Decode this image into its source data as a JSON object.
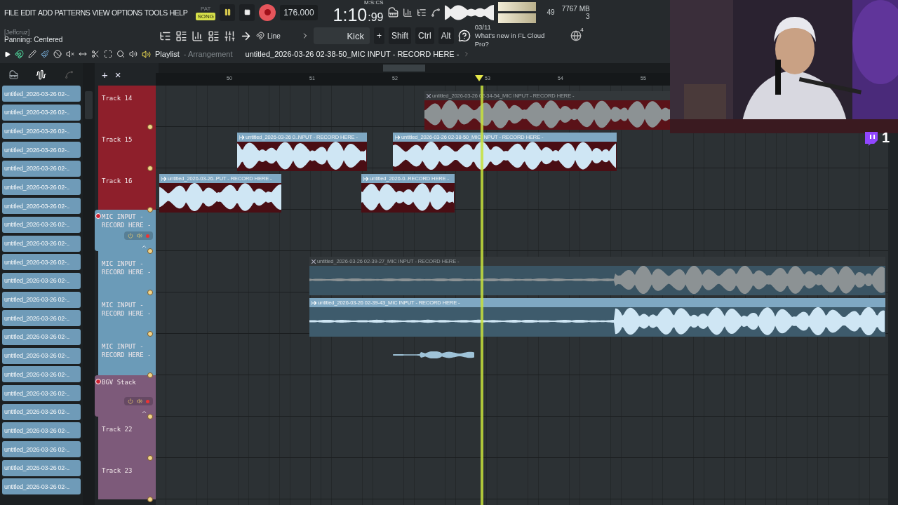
{
  "menu": [
    "FILE",
    "EDIT",
    "ADD",
    "PATTERNS",
    "VIEW",
    "OPTIONS",
    "TOOLS",
    "HELP"
  ],
  "mode": [
    {
      "label": "PAT",
      "selected": false
    },
    {
      "label": "SONG",
      "selected": true
    }
  ],
  "transport": {
    "playing": true,
    "recording": true,
    "tempo": "176.000"
  },
  "time": {
    "value": "1:10",
    "centiseconds": ":99",
    "format": "M:S:CS"
  },
  "cpu": {
    "voices": "49",
    "memory": "7767 MB",
    "polyphony": "3"
  },
  "hint": {
    "owner": "[Jeffcruz]",
    "message": "Panning: Centered"
  },
  "snap": {
    "value": "Line"
  },
  "pattern": {
    "value": "Kick",
    "add": "+"
  },
  "modifiers": [
    "Shift",
    "Ctrl",
    "Alt"
  ],
  "news": {
    "date": "03/11",
    "text": "What's new in FL Cloud Pro?"
  },
  "online": {
    "count": "4"
  },
  "playlist": {
    "title": "Playlist",
    "view": "- Arrangement",
    "clip": "untitled_2026-03-26 02-38-50_MIC INPUT - RECORD HERE -"
  },
  "clip_list": [
    "untitled_2026-03-26 02-..",
    "untitled_2026-03-26 02-..",
    "untitled_2026-03-26 02-..",
    "untitled_2026-03-26 02-..",
    "untitled_2026-03-26 02-..",
    "untitled_2026-03-26 02-..",
    "untitled_2026-03-26 02-..",
    "untitled_2026-03-26 02-..",
    "untitled_2026-03-26 02-..",
    "untitled_2026-03-26 02-..",
    "untitled_2026-03-26 02-..",
    "untitled_2026-03-26 02-..",
    "untitled_2026-03-26 02-..",
    "untitled_2026-03-26 02-..",
    "untitled_2026-03-26 02-..",
    "untitled_2026-03-26 02-..",
    "untitled_2026-03-26 02-..",
    "untitled_2026-03-26 02-..",
    "untitled_2026-03-26 02-..",
    "untitled_2026-03-26 02-..",
    "untitled_2026-03-26 02-..",
    "untitled_2026-03-26 02-.."
  ],
  "header_tools": {
    "add": "+",
    "delete": "×"
  },
  "ruler": [
    "50",
    "51",
    "52",
    "53",
    "54",
    "55"
  ],
  "tracks": [
    {
      "name": "Track 14",
      "kind": "track",
      "color": "#8e1f2b",
      "clips": [
        {
          "label": "untitled_2026-03-26 02-34-54_MIC INPUT - RECORD HERE -",
          "muted": true
        }
      ]
    },
    {
      "name": "Track 15",
      "kind": "track",
      "color": "#8e1f2b",
      "clips": [
        {
          "label": "untitled_2026-03-26 0..NPUT - RECORD HERE -",
          "muted": false
        },
        {
          "label": "untitled_2026-03-26 02-38-50_MIC INPUT - RECORD HERE -",
          "muted": false
        }
      ]
    },
    {
      "name": "Track 16",
      "kind": "track",
      "color": "#8e1f2b",
      "clips": [
        {
          "label": "untitled_2026-03-26..PUT - RECORD HERE -",
          "muted": false
        },
        {
          "label": "untitled_2026-0..RECORD HERE -",
          "muted": false
        }
      ]
    },
    {
      "name": "MIC INPUT - RECORD HERE -",
      "kind": "group",
      "color": "#6b9bb8"
    },
    {
      "name": "MIC INPUT - RECORD HERE -",
      "kind": "track",
      "color": "#6b9bb8",
      "clips": [
        {
          "label": "untitled_2026-03-26 02-39-27_MIC INPUT - RECORD HERE -",
          "muted": true
        }
      ]
    },
    {
      "name": "MIC INPUT - RECORD HERE -",
      "kind": "track",
      "color": "#6b9bb8",
      "clips": [
        {
          "label": "untitled_2026-03-26 02-39-43_MIC INPUT - RECORD HERE -",
          "muted": false
        }
      ]
    },
    {
      "name": "MIC INPUT - RECORD HERE -",
      "kind": "track",
      "color": "#6b9bb8"
    },
    {
      "name": "BGV Stack",
      "kind": "group",
      "color": "#7d5a7a"
    },
    {
      "name": "Track 22",
      "kind": "track",
      "color": "#7d5a7a"
    },
    {
      "name": "Track 23",
      "kind": "track",
      "color": "#7d5a7a"
    }
  ],
  "notification": {
    "count": "1"
  }
}
